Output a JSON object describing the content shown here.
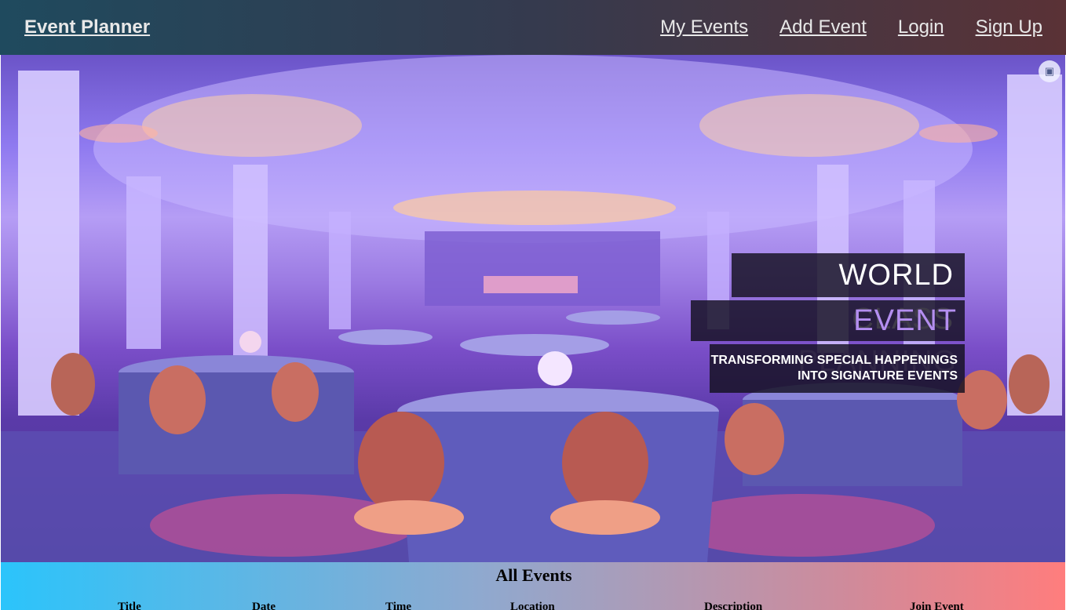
{
  "nav": {
    "brand": "Event Planner",
    "links": [
      "My Events",
      "Add Event",
      "Login",
      "Sign Up"
    ]
  },
  "hero": {
    "banner_line1": "WORLD CLASS",
    "banner_line2": "EVENT PLANNING",
    "banner_line3a": "TRANSFORMING SPECIAL HAPPENINGS",
    "banner_line3b": "INTO SIGNATURE EVENTS",
    "lens_icon": "visual-search-icon"
  },
  "events": {
    "title": "All Events",
    "columns": [
      "Title",
      "Date",
      "Time",
      "Location",
      "Description",
      "Join Event"
    ]
  },
  "colors": {
    "nav_start": "#1f4a5e",
    "nav_end": "#5a3236",
    "section_start": "#2bc4fb",
    "section_end": "#ff7d7d",
    "banner_accent": "#b48ef0"
  }
}
